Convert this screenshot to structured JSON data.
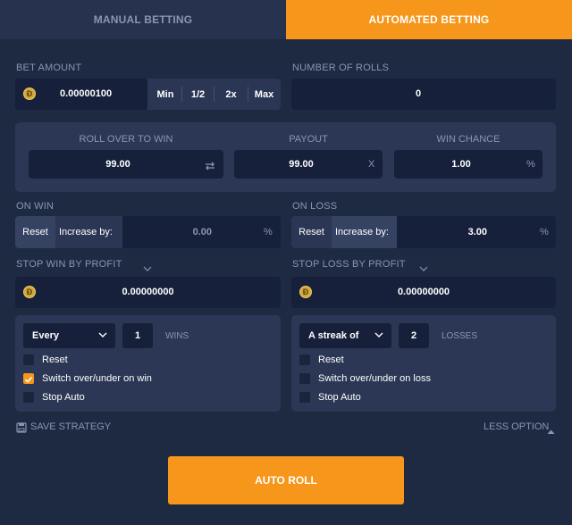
{
  "tabs": {
    "manual": "MANUAL BETTING",
    "auto": "AUTOMATED BETTING",
    "active": "auto"
  },
  "bet": {
    "label": "BET AMOUNT",
    "coin_glyph": "Ð",
    "value": "0.00000100",
    "quick": [
      "Min",
      "1/2",
      "2x",
      "Max"
    ]
  },
  "rolls": {
    "label": "NUMBER OF ROLLS",
    "value": "0"
  },
  "roll_panel": {
    "roll_over": {
      "label": "ROLL OVER TO WIN",
      "value": "99.00",
      "icon": "swap-icon"
    },
    "payout": {
      "label": "PAYOUT",
      "value": "99.00",
      "suffix": "X"
    },
    "win_chance": {
      "label": "WIN CHANCE",
      "value": "1.00",
      "suffix": "%"
    }
  },
  "on_win": {
    "label": "ON WIN",
    "reset": "Reset",
    "increase_label": "Increase by:",
    "value": "0.00",
    "suffix": "%"
  },
  "on_loss": {
    "label": "ON LOSS",
    "reset": "Reset",
    "increase_label": "Increase by:",
    "value": "3.00",
    "suffix": "%"
  },
  "stop_win": {
    "label": "STOP WIN BY PROFIT",
    "value": "0.00000000"
  },
  "stop_loss": {
    "label": "STOP LOSS BY PROFIT",
    "value": "0.00000000"
  },
  "win_rule": {
    "mode": "Every",
    "count": "1",
    "kind": "WINS",
    "options": [
      {
        "label": "Reset",
        "checked": false
      },
      {
        "label": "Switch over/under on win",
        "checked": true
      },
      {
        "label": "Stop Auto",
        "checked": false
      }
    ]
  },
  "loss_rule": {
    "mode": "A streak of",
    "count": "2",
    "kind": "LOSSES",
    "options": [
      {
        "label": "Reset",
        "checked": false
      },
      {
        "label": "Switch over/under on loss",
        "checked": false
      },
      {
        "label": "Stop Auto",
        "checked": false
      }
    ]
  },
  "footer": {
    "save": "SAVE STRATEGY",
    "less": "LESS OPTION"
  },
  "auto_roll": "AUTO ROLL",
  "colors": {
    "accent": "#f6961a",
    "background": "#1e2942",
    "field": "#16203a",
    "panel": "#2b3755"
  }
}
